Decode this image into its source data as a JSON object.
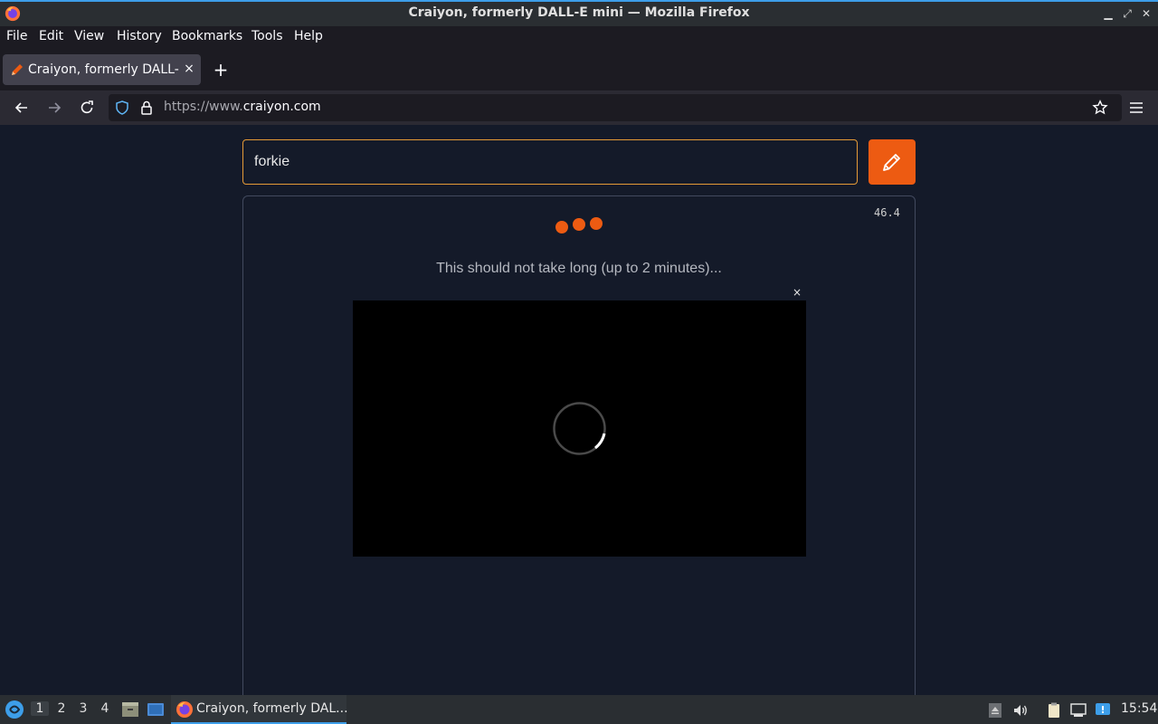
{
  "window": {
    "title": "Craiyon, formerly DALL-E mini — Mozilla Firefox"
  },
  "menu": {
    "file": "File",
    "edit": "Edit",
    "view": "View",
    "history": "History",
    "bookmarks": "Bookmarks",
    "tools": "Tools",
    "help": "Help"
  },
  "tabs": [
    {
      "label": "Craiyon, formerly DALL-E mini",
      "close": "×"
    }
  ],
  "newtab": "+",
  "urlbar": {
    "prefix": "https://www.",
    "domain": "craiyon.com"
  },
  "page": {
    "prompt_value": "forkie",
    "timer": "46.4",
    "wait_message": "This should not take long (up to 2 minutes)...",
    "ad_close": "×",
    "accent": "#ed5b12"
  },
  "taskbar": {
    "workspaces": [
      "1",
      "2",
      "3",
      "4"
    ],
    "active_workspace": "1",
    "task_label": "Craiyon, formerly DAL...",
    "clock": "15:54"
  }
}
